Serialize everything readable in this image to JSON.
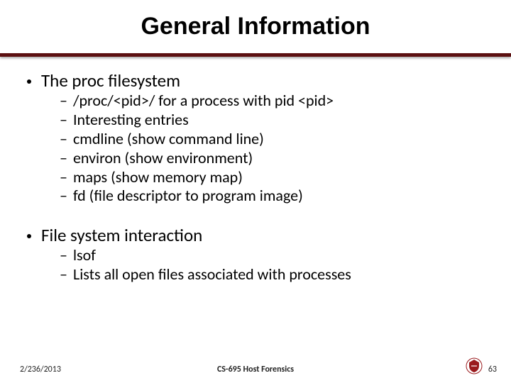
{
  "title": "General Information",
  "bullets": [
    {
      "label": "The proc filesystem",
      "subs": [
        "/proc/<pid>/ for a process with pid <pid>",
        "Interesting entries",
        "cmdline (show command line)",
        "environ (show environment)",
        "maps (show memory map)",
        "fd (file descriptor to program image)"
      ]
    },
    {
      "label": "File system interaction",
      "subs": [
        "lsof",
        "Lists all open files associated with processes"
      ]
    }
  ],
  "footer": {
    "date": "2/236/2013",
    "center": "CS-695 Host Forensics",
    "page": "63"
  },
  "colors": {
    "divider": "#5b0f10",
    "logo": "#9a1b1e"
  }
}
